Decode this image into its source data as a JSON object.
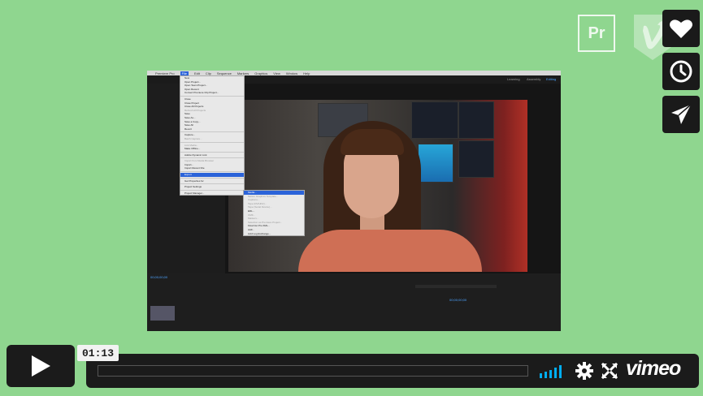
{
  "badges": {
    "pr_label": "Pr",
    "vimeo_badge_icon": "vimeo-v-shield-icon"
  },
  "side_buttons": [
    {
      "icon": "heart-icon"
    },
    {
      "icon": "clock-icon"
    },
    {
      "icon": "paper-plane-icon"
    }
  ],
  "video_frame": {
    "macmenu": [
      "Premiere Pro",
      "File",
      "Edit",
      "Clip",
      "Sequence",
      "Markers",
      "Graphics",
      "View",
      "Window",
      "Help"
    ],
    "workspaces": [
      "Learning",
      "Assembly",
      "Editing"
    ],
    "file_menu": [
      {
        "label": "New",
        "state": "normal"
      },
      {
        "label": "Open Project...",
        "state": "normal"
      },
      {
        "label": "Open Team Project...",
        "state": "normal"
      },
      {
        "label": "Open Recent",
        "state": "normal"
      },
      {
        "label": "Convert Premiere Clip Project...",
        "state": "normal"
      },
      {
        "label": "",
        "state": "sep"
      },
      {
        "label": "Close",
        "state": "normal"
      },
      {
        "label": "Close Project",
        "state": "normal"
      },
      {
        "label": "Close All Projects",
        "state": "normal"
      },
      {
        "label": "Refresh All Projects",
        "state": "dis"
      },
      {
        "label": "Save",
        "state": "normal"
      },
      {
        "label": "Save As...",
        "state": "normal"
      },
      {
        "label": "Save a Copy...",
        "state": "normal"
      },
      {
        "label": "Save All",
        "state": "normal"
      },
      {
        "label": "Revert",
        "state": "normal"
      },
      {
        "label": "",
        "state": "sep"
      },
      {
        "label": "Capture...",
        "state": "normal"
      },
      {
        "label": "Batch Capture...",
        "state": "dis"
      },
      {
        "label": "",
        "state": "sep"
      },
      {
        "label": "Link Media...",
        "state": "dis"
      },
      {
        "label": "Make Offline...",
        "state": "normal"
      },
      {
        "label": "",
        "state": "sep"
      },
      {
        "label": "Adobe Dynamic Link",
        "state": "normal"
      },
      {
        "label": "",
        "state": "sep"
      },
      {
        "label": "Import from Media Browser",
        "state": "dis"
      },
      {
        "label": "Import...",
        "state": "normal"
      },
      {
        "label": "Import Recent File",
        "state": "normal"
      },
      {
        "label": "",
        "state": "sep"
      },
      {
        "label": "Export",
        "state": "hl"
      },
      {
        "label": "",
        "state": "sep"
      },
      {
        "label": "Get Properties for",
        "state": "normal"
      },
      {
        "label": "",
        "state": "sep"
      },
      {
        "label": "Project Settings",
        "state": "normal"
      },
      {
        "label": "",
        "state": "sep"
      },
      {
        "label": "Project Manager...",
        "state": "normal"
      }
    ],
    "export_menu": [
      {
        "label": "Media...",
        "state": "hl"
      },
      {
        "label": "Motion Graphics Template...",
        "state": "dis"
      },
      {
        "label": "Captions...",
        "state": "dis"
      },
      {
        "label": "Tape (DV/HDV)...",
        "state": "dis"
      },
      {
        "label": "Tape (Serial Device)...",
        "state": "dis"
      },
      {
        "label": "EDL...",
        "state": "normal"
      },
      {
        "label": "OMF...",
        "state": "dis"
      },
      {
        "label": "Markers...",
        "state": "dis"
      },
      {
        "label": "Selection as Premiere Project...",
        "state": "dis"
      },
      {
        "label": "Final Cut Pro XML...",
        "state": "normal"
      },
      {
        "label": "AAF...",
        "state": "normal"
      },
      {
        "label": "Avid Log Exchange...",
        "state": "normal"
      }
    ],
    "timecode_left": "00;00;00;00",
    "timecode_right": "00;00;00;00"
  },
  "player": {
    "time": "01:13",
    "progress": 0.0,
    "logo": "vimeo",
    "icons": [
      "play-icon",
      "volume-icon",
      "settings-gear-icon",
      "fullscreen-icon"
    ]
  }
}
